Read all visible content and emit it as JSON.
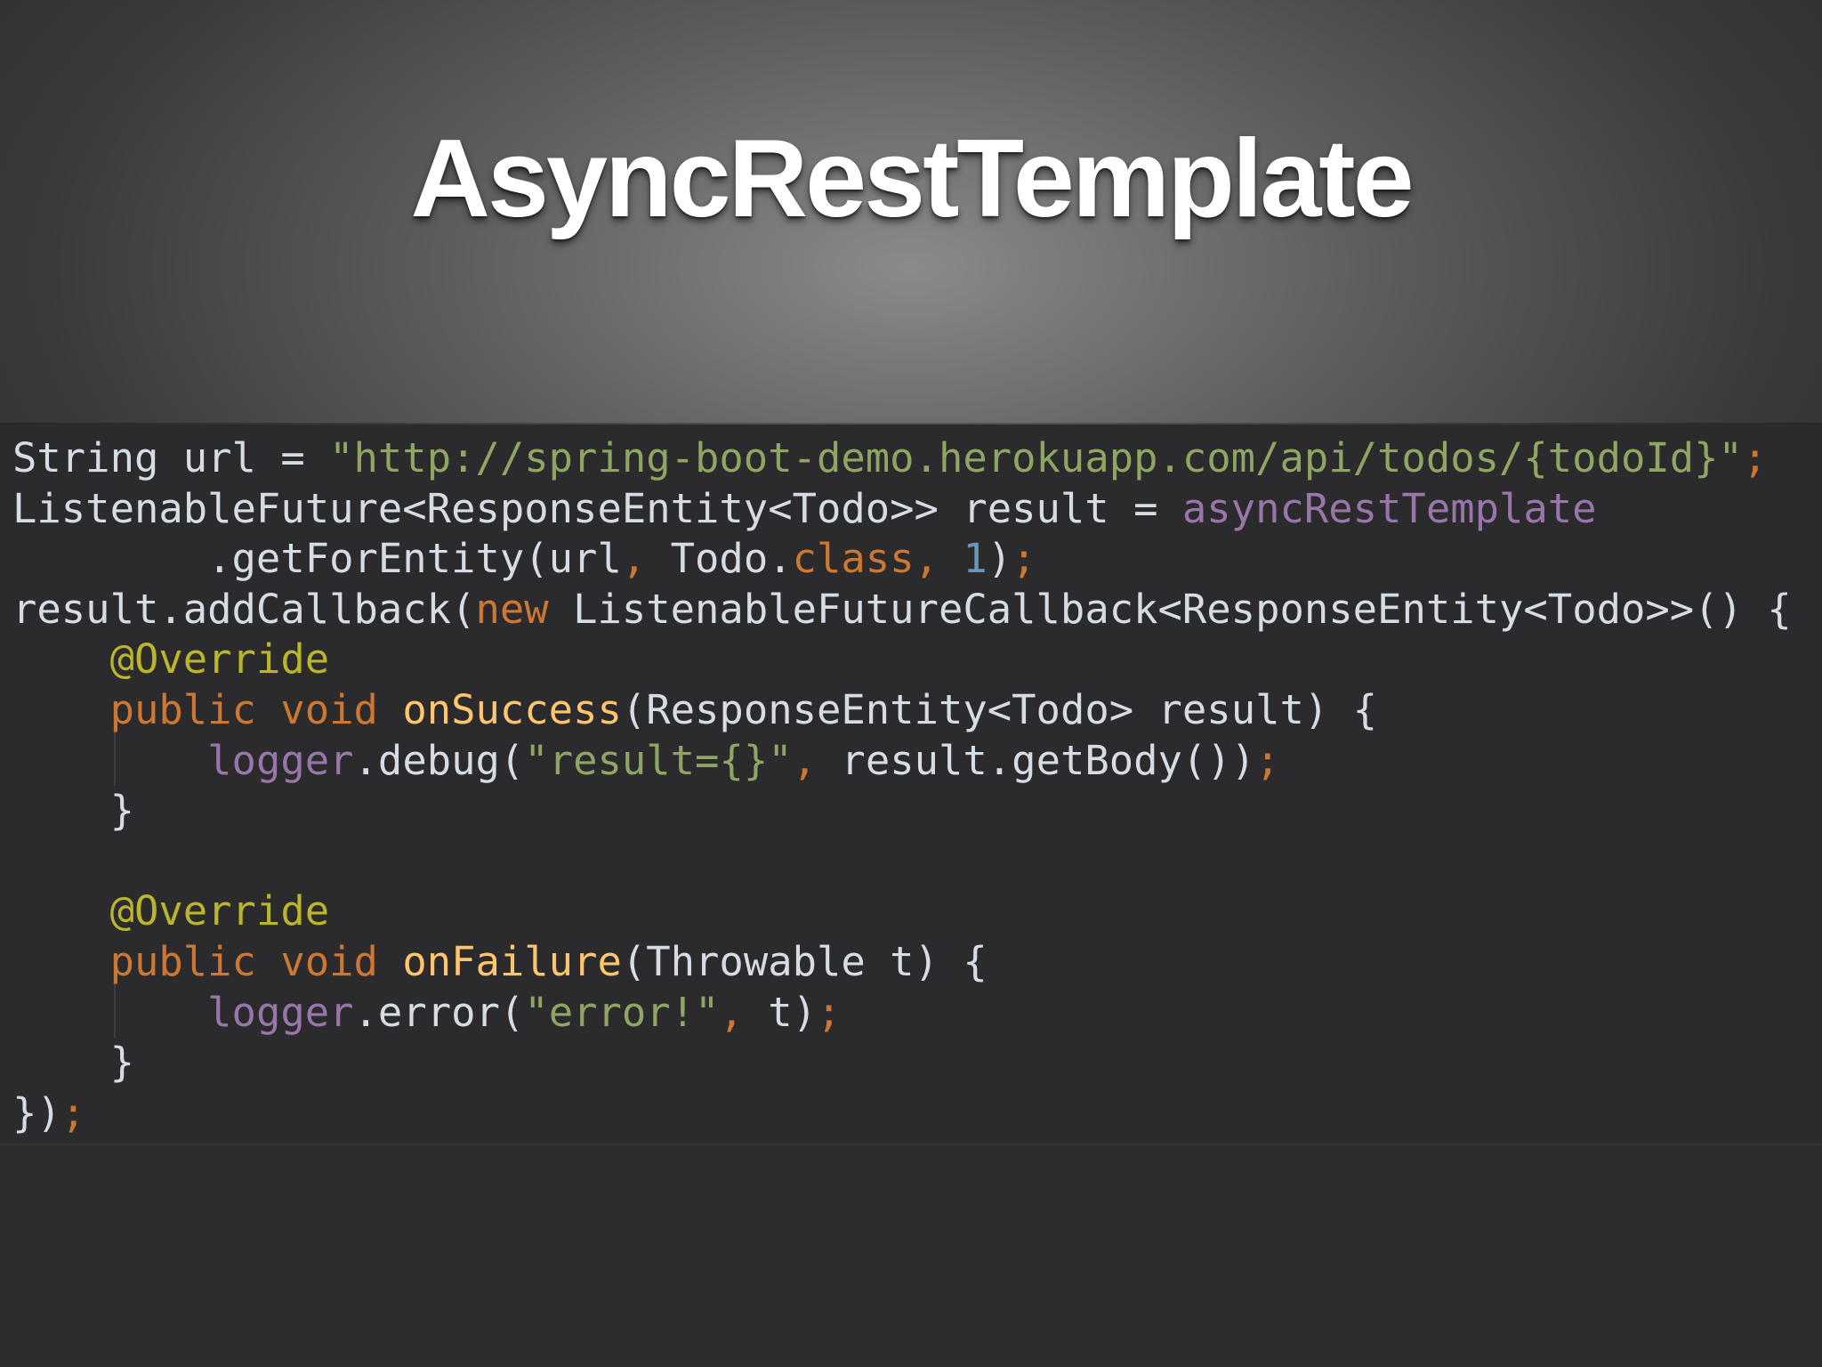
{
  "slide": {
    "title": "AsyncRestTemplate"
  },
  "code": {
    "language": "java",
    "lines": [
      [
        {
          "t": "String url = ",
          "c": "pl"
        },
        {
          "t": "\"http://spring-boot-demo.herokuapp.com/api/todos/{todoId}\"",
          "c": "str"
        },
        {
          "t": ";",
          "c": "kw"
        }
      ],
      [
        {
          "t": "ListenableFuture<ResponseEntity<Todo>> result = ",
          "c": "pl"
        },
        {
          "t": "asyncRestTemplate",
          "c": "fld"
        }
      ],
      [
        {
          "t": "        .getForEntity(url",
          "c": "pl"
        },
        {
          "t": ",",
          "c": "kw"
        },
        {
          "t": " Todo.",
          "c": "pl"
        },
        {
          "t": "class",
          "c": "kw"
        },
        {
          "t": ",",
          "c": "kw"
        },
        {
          "t": " ",
          "c": "pl"
        },
        {
          "t": "1",
          "c": "num"
        },
        {
          "t": ")",
          "c": "pl"
        },
        {
          "t": ";",
          "c": "kw"
        }
      ],
      [
        {
          "t": "result.addCallback(",
          "c": "pl"
        },
        {
          "t": "new",
          "c": "kw"
        },
        {
          "t": " ListenableFutureCallback<ResponseEntity<Todo>>() {",
          "c": "pl"
        }
      ],
      [
        {
          "t": "    ",
          "c": "pl"
        },
        {
          "t": "@Override",
          "c": "ann"
        }
      ],
      [
        {
          "t": "    ",
          "c": "pl"
        },
        {
          "t": "public void ",
          "c": "kw"
        },
        {
          "t": "onSuccess",
          "c": "fn"
        },
        {
          "t": "(ResponseEntity<Todo> result) {",
          "c": "pl"
        }
      ],
      [
        {
          "t": "        ",
          "c": "pl"
        },
        {
          "t": "logger",
          "c": "fld"
        },
        {
          "t": ".debug(",
          "c": "pl"
        },
        {
          "t": "\"result={}\"",
          "c": "str"
        },
        {
          "t": ",",
          "c": "kw"
        },
        {
          "t": " result.getBody())",
          "c": "pl"
        },
        {
          "t": ";",
          "c": "kw"
        }
      ],
      [
        {
          "t": "    }",
          "c": "pl"
        }
      ],
      [
        {
          "t": "",
          "c": "pl"
        }
      ],
      [
        {
          "t": "    ",
          "c": "pl"
        },
        {
          "t": "@Override",
          "c": "ann"
        }
      ],
      [
        {
          "t": "    ",
          "c": "pl"
        },
        {
          "t": "public void ",
          "c": "kw"
        },
        {
          "t": "onFailure",
          "c": "fn"
        },
        {
          "t": "(Throwable t) {",
          "c": "pl"
        }
      ],
      [
        {
          "t": "        ",
          "c": "pl"
        },
        {
          "t": "logger",
          "c": "fld"
        },
        {
          "t": ".error(",
          "c": "pl"
        },
        {
          "t": "\"error!\"",
          "c": "str"
        },
        {
          "t": ",",
          "c": "kw"
        },
        {
          "t": " t)",
          "c": "pl"
        },
        {
          "t": ";",
          "c": "kw"
        }
      ],
      [
        {
          "t": "    }",
          "c": "pl"
        }
      ],
      [
        {
          "t": "})",
          "c": "pl"
        },
        {
          "t": ";",
          "c": "kw"
        }
      ]
    ]
  },
  "colors": {
    "code_background": "#2b2b2d",
    "string": "#8fa663",
    "keyword": "#cc7832",
    "annotation": "#bbb529",
    "method_declaration": "#ffc66d",
    "number": "#6897bb",
    "field": "#9876aa",
    "plain": "#d6dce4"
  }
}
